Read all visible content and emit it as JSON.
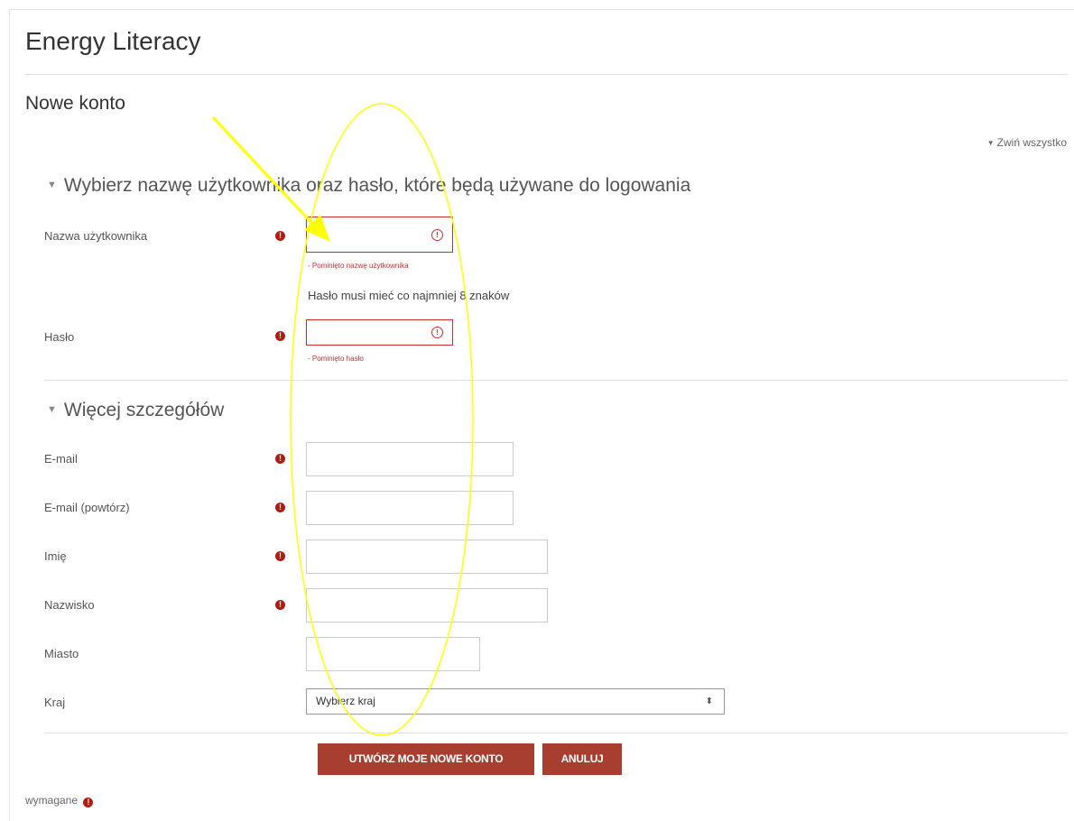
{
  "site": {
    "title": "Energy Literacy"
  },
  "page": {
    "heading": "Nowe konto",
    "collapse_all": "Zwiń wszystko"
  },
  "section1": {
    "title": "Wybierz nazwę użytkownika oraz hasło, które będą używane do logowania",
    "username_label": "Nazwa użytkownika",
    "username_error": "- Pominięto nazwę użytkownika",
    "password_hint": "Hasło musi mieć co najmniej 8 znaków",
    "password_label": "Hasło",
    "password_error": "- Pominięto hasło"
  },
  "section2": {
    "title": "Więcej szczegółów",
    "email_label": "E-mail",
    "email2_label": "E-mail (powtórz)",
    "firstname_label": "Imię",
    "lastname_label": "Nazwisko",
    "city_label": "Miasto",
    "country_label": "Kraj",
    "country_value": "Wybierz kraj"
  },
  "buttons": {
    "create": "UTWÓRZ MOJE NOWE KONTO",
    "cancel": "ANULUJ"
  },
  "footer": {
    "required_note": "wymagane"
  },
  "icons": {
    "required": "exclamation-circle-icon",
    "error": "exclamation-outline-icon",
    "collapse": "triangle-down-icon"
  },
  "colors": {
    "required_red": "#b41b0e",
    "error_red": "#c9302c",
    "button": "#a83e30",
    "annotation_yellow": "#ffff00"
  }
}
